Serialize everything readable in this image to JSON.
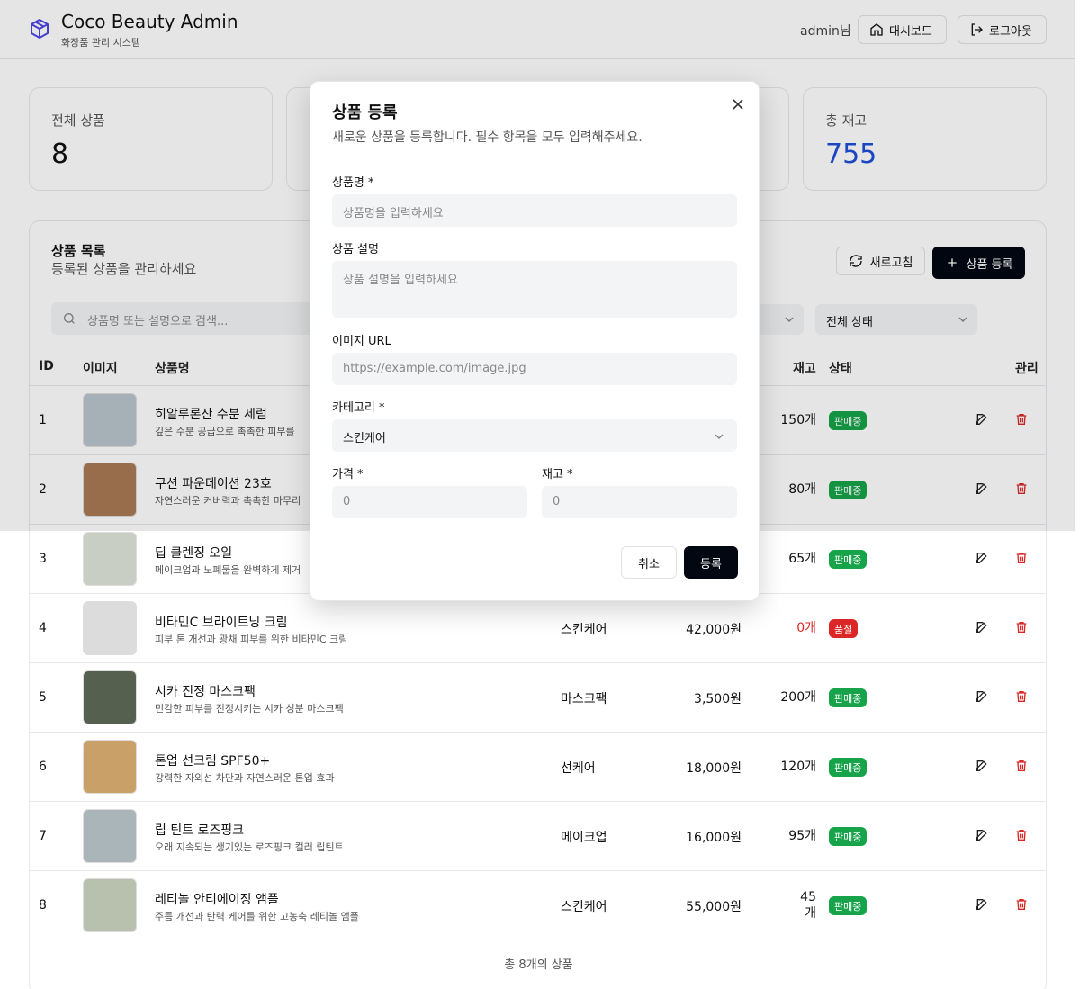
{
  "header": {
    "title": "Coco Beauty Admin",
    "subtitle": "화장품 관리 시스템",
    "user": "admin님",
    "dashboard_label": "대시보드",
    "logout_label": "로그아웃"
  },
  "stats": [
    {
      "label": "전체 상품",
      "value": "8"
    },
    {
      "label": "",
      "value": ""
    },
    {
      "label": "",
      "value": ""
    },
    {
      "label": "총 재고",
      "value": "755"
    }
  ],
  "list": {
    "title": "상품 목록",
    "subtitle": "등록된 상품을 관리하세요",
    "refresh_label": "새로고침",
    "add_label": "상품 등록",
    "search_placeholder": "상품명 또는 설명으로 검색...",
    "status_filter": "전체 상태",
    "columns": {
      "id": "ID",
      "image": "이미지",
      "name": "상품명",
      "stock": "재고",
      "status": "상태",
      "actions": "관리"
    },
    "rows": [
      {
        "id": "1",
        "name": "히알루론산 수분 세럼",
        "desc": "깊은 수분 공급으로 촉촉한 피부를",
        "category": "",
        "price": "",
        "stock": "150개",
        "status": "판매중",
        "status_color": "#16a34a",
        "img_color": "#b9c4cc"
      },
      {
        "id": "2",
        "name": "쿠션 파운데이션 23호",
        "desc": "자연스러운 커버력과 촉촉한 마무리",
        "category": "",
        "price": "",
        "stock": "80개",
        "status": "판매중",
        "status_color": "#16a34a",
        "img_color": "#a97a55"
      },
      {
        "id": "3",
        "name": "딥 클렌징 오일",
        "desc": "메이크업과 노폐물을 완벽하게 제거",
        "category": "",
        "price": "",
        "stock": "65개",
        "status": "판매중",
        "status_color": "#16a34a",
        "img_color": "#c9cec5"
      },
      {
        "id": "4",
        "name": "비타민C 브라이트닝 크림",
        "desc": "피부 톤 개선과 광채 피부를 위한 비타민C 크림",
        "category": "스킨케어",
        "price": "42,000원",
        "stock": "0개",
        "status": "품절",
        "status_color": "#dc2626",
        "img_color": "#dcdcdc"
      },
      {
        "id": "5",
        "name": "시카 진정 마스크팩",
        "desc": "민감한 피부를 진정시키는 시카 성분 마스크팩",
        "category": "마스크팩",
        "price": "3,500원",
        "stock": "200개",
        "status": "판매중",
        "status_color": "#16a34a",
        "img_color": "#56604f"
      },
      {
        "id": "6",
        "name": "톤업 선크림 SPF50+",
        "desc": "강력한 자외선 차단과 자연스러운 톤업 효과",
        "category": "선케어",
        "price": "18,000원",
        "stock": "120개",
        "status": "판매중",
        "status_color": "#16a34a",
        "img_color": "#caa069"
      },
      {
        "id": "7",
        "name": "립 틴트 로즈핑크",
        "desc": "오래 지속되는 생기있는 로즈핑크 컬러 립틴트",
        "category": "메이크업",
        "price": "16,000원",
        "stock": "95개",
        "status": "판매중",
        "status_color": "#16a34a",
        "img_color": "#a9b5b8"
      },
      {
        "id": "8",
        "name": "레티놀 안티에이징 앰플",
        "desc": "주름 개선과 탄력 케어를 위한 고농축 레티놀 앰플",
        "category": "스킨케어",
        "price": "55,000원",
        "stock": "45\n개",
        "status": "판매중",
        "status_color": "#16a34a",
        "img_color": "#b8c0ae"
      }
    ],
    "footer": "총 8개의 상품"
  },
  "modal": {
    "title": "상품 등록",
    "description": "새로운 상품을 등록합니다. 필수 항목을 모두 입력해주세요.",
    "name_label": "상품명 *",
    "name_placeholder": "상품명을 입력하세요",
    "desc_label": "상품 설명",
    "desc_placeholder": "상품 설명을 입력하세요",
    "image_label": "이미지 URL",
    "image_placeholder": "https://example.com/image.jpg",
    "category_label": "카테고리 *",
    "category_value": "스킨케어",
    "price_label": "가격 *",
    "price_placeholder": "0",
    "stock_label": "재고 *",
    "stock_placeholder": "0",
    "cancel_label": "취소",
    "submit_label": "등록"
  }
}
